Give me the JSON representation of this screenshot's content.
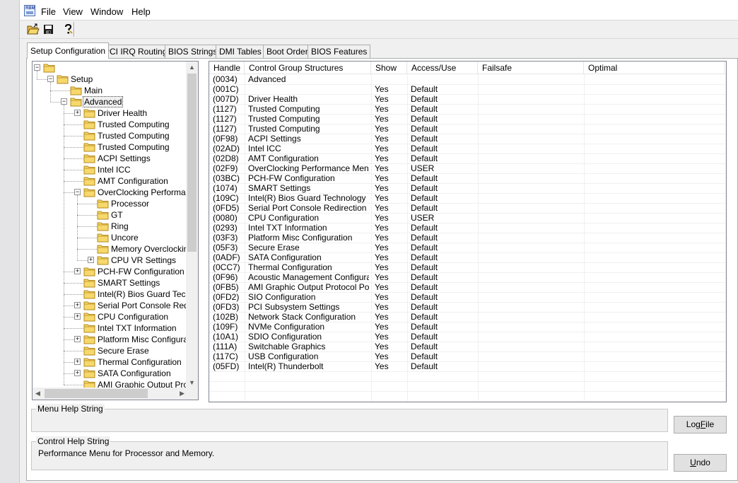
{
  "menubar": {
    "app_icon_text": "RBM",
    "items": [
      "File",
      "View",
      "Window",
      "Help"
    ]
  },
  "toolbar": {
    "buttons": [
      "open-folder-icon",
      "save-icon",
      "help-icon"
    ]
  },
  "tabs": [
    {
      "label": "Setup Configuration",
      "active": true
    },
    {
      "label": "PCI IRQ Routing",
      "active": false
    },
    {
      "label": "BIOS Strings",
      "active": false
    },
    {
      "label": "DMI Tables",
      "active": false
    },
    {
      "label": "Boot Order",
      "active": false
    },
    {
      "label": "BIOS Features",
      "active": false
    }
  ],
  "tree": {
    "nodes": [
      {
        "label": "",
        "depth": 0,
        "expander": "-",
        "selected": false
      },
      {
        "label": "Setup",
        "depth": 1,
        "expander": "-",
        "selected": false
      },
      {
        "label": "Main",
        "depth": 2,
        "expander": "",
        "selected": false
      },
      {
        "label": "Advanced",
        "depth": 2,
        "expander": "-",
        "selected": true
      },
      {
        "label": "Driver Health",
        "depth": 3,
        "expander": "+",
        "selected": false
      },
      {
        "label": "Trusted Computing",
        "depth": 3,
        "expander": "",
        "selected": false
      },
      {
        "label": "Trusted Computing",
        "depth": 3,
        "expander": "",
        "selected": false
      },
      {
        "label": "Trusted Computing",
        "depth": 3,
        "expander": "",
        "selected": false
      },
      {
        "label": "ACPI Settings",
        "depth": 3,
        "expander": "",
        "selected": false
      },
      {
        "label": "Intel ICC",
        "depth": 3,
        "expander": "",
        "selected": false
      },
      {
        "label": "AMT Configuration",
        "depth": 3,
        "expander": "",
        "selected": false
      },
      {
        "label": "OverClocking Performanc",
        "depth": 3,
        "expander": "-",
        "selected": false
      },
      {
        "label": "Processor",
        "depth": 4,
        "expander": "",
        "selected": false
      },
      {
        "label": "GT",
        "depth": 4,
        "expander": "",
        "selected": false
      },
      {
        "label": "Ring",
        "depth": 4,
        "expander": "",
        "selected": false
      },
      {
        "label": "Uncore",
        "depth": 4,
        "expander": "",
        "selected": false
      },
      {
        "label": "Memory Overclocking",
        "depth": 4,
        "expander": "",
        "selected": false
      },
      {
        "label": "CPU VR Settings",
        "depth": 4,
        "expander": "+",
        "selected": false
      },
      {
        "label": "PCH-FW Configuration",
        "depth": 3,
        "expander": "+",
        "selected": false
      },
      {
        "label": "SMART Settings",
        "depth": 3,
        "expander": "",
        "selected": false
      },
      {
        "label": "Intel(R) Bios Guard Techr",
        "depth": 3,
        "expander": "",
        "selected": false
      },
      {
        "label": "Serial Port Console Redire",
        "depth": 3,
        "expander": "+",
        "selected": false
      },
      {
        "label": "CPU Configuration",
        "depth": 3,
        "expander": "+",
        "selected": false
      },
      {
        "label": "Intel TXT Information",
        "depth": 3,
        "expander": "",
        "selected": false
      },
      {
        "label": "Platform Misc Configurati",
        "depth": 3,
        "expander": "+",
        "selected": false
      },
      {
        "label": "Secure Erase",
        "depth": 3,
        "expander": "",
        "selected": false
      },
      {
        "label": "Thermal Configuration",
        "depth": 3,
        "expander": "+",
        "selected": false
      },
      {
        "label": "SATA Configuration",
        "depth": 3,
        "expander": "+",
        "selected": false
      },
      {
        "label": "AMI Graphic Output Proto",
        "depth": 3,
        "expander": "",
        "selected": false
      }
    ]
  },
  "table": {
    "columns": [
      "Handle",
      "Control Group Structures",
      "Show",
      "Access/Use",
      "Failsafe",
      "Optimal"
    ],
    "rows": [
      [
        "(0034)",
        "Advanced",
        "",
        "",
        "",
        ""
      ],
      [
        "(001C)",
        "",
        "Yes",
        "Default",
        "",
        ""
      ],
      [
        "(007D)",
        "Driver Health",
        "Yes",
        "Default",
        "",
        ""
      ],
      [
        "(1127)",
        "Trusted Computing",
        "Yes",
        "Default",
        "",
        ""
      ],
      [
        "(1127)",
        "Trusted Computing",
        "Yes",
        "Default",
        "",
        ""
      ],
      [
        "(1127)",
        "Trusted Computing",
        "Yes",
        "Default",
        "",
        ""
      ],
      [
        "(0F98)",
        "ACPI Settings",
        "Yes",
        "Default",
        "",
        ""
      ],
      [
        "(02AD)",
        "Intel ICC",
        "Yes",
        "Default",
        "",
        ""
      ],
      [
        "(02D8)",
        "AMT Configuration",
        "Yes",
        "Default",
        "",
        ""
      ],
      [
        "(02F9)",
        "OverClocking Performance Menu",
        "Yes",
        "USER",
        "",
        ""
      ],
      [
        "(03BC)",
        "PCH-FW Configuration",
        "Yes",
        "Default",
        "",
        ""
      ],
      [
        "(1074)",
        "SMART Settings",
        "Yes",
        "Default",
        "",
        ""
      ],
      [
        "(109C)",
        "Intel(R) Bios Guard Technology",
        "Yes",
        "Default",
        "",
        ""
      ],
      [
        "(0FD5)",
        "Serial Port Console Redirection",
        "Yes",
        "Default",
        "",
        ""
      ],
      [
        "(0080)",
        "CPU Configuration",
        "Yes",
        "USER",
        "",
        ""
      ],
      [
        "(0293)",
        "Intel TXT Information",
        "Yes",
        "Default",
        "",
        ""
      ],
      [
        "(03F3)",
        "Platform Misc Configuration",
        "Yes",
        "Default",
        "",
        ""
      ],
      [
        "(05F3)",
        "Secure Erase",
        "Yes",
        "Default",
        "",
        ""
      ],
      [
        "(0ADF)",
        "SATA Configuration",
        "Yes",
        "Default",
        "",
        ""
      ],
      [
        "(0CC7)",
        "Thermal Configuration",
        "Yes",
        "Default",
        "",
        ""
      ],
      [
        "(0F96)",
        "Acoustic Management Configurati...",
        "Yes",
        "Default",
        "",
        ""
      ],
      [
        "(0FB5)",
        "AMI Graphic Output Protocol Policy",
        "Yes",
        "Default",
        "",
        ""
      ],
      [
        "(0FD2)",
        "SIO Configuration",
        "Yes",
        "Default",
        "",
        ""
      ],
      [
        "(0FD3)",
        "PCI Subsystem Settings",
        "Yes",
        "Default",
        "",
        ""
      ],
      [
        "(102B)",
        "Network Stack Configuration",
        "Yes",
        "Default",
        "",
        ""
      ],
      [
        "(109F)",
        "NVMe Configuration",
        "Yes",
        "Default",
        "",
        ""
      ],
      [
        "(10A1)",
        "SDIO Configuration",
        "Yes",
        "Default",
        "",
        ""
      ],
      [
        "(111A)",
        "Switchable Graphics",
        "Yes",
        "Default",
        "",
        ""
      ],
      [
        "(117C)",
        "USB Configuration",
        "Yes",
        "Default",
        "",
        ""
      ],
      [
        "(05FD)",
        "Intel(R) Thunderbolt",
        "Yes",
        "Default",
        "",
        ""
      ]
    ]
  },
  "help": {
    "menu_help_label": "Menu Help String",
    "menu_help_text": "",
    "control_help_label": "Control Help String",
    "control_help_text": "Performance Menu for Processor and Memory."
  },
  "buttons": {
    "logfile_prefix": "Log",
    "logfile_mnemonic": "F",
    "logfile_suffix": "ile",
    "undo_mnemonic": "U",
    "undo_suffix": "ndo"
  },
  "colors": {
    "folder_fill": "#f6d86b",
    "folder_edge": "#b48a1e",
    "selection_outline": "#333333"
  }
}
